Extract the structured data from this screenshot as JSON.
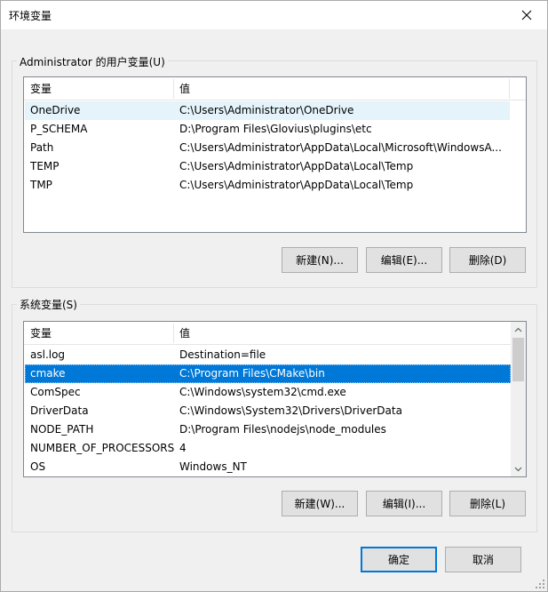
{
  "window": {
    "title": "环境变量"
  },
  "user_vars": {
    "group_label": "Administrator 的用户变量(U)",
    "col_name": "变量",
    "col_value": "值",
    "rows": [
      {
        "name": "OneDrive",
        "value": "C:\\Users\\Administrator\\OneDrive"
      },
      {
        "name": "P_SCHEMA",
        "value": "D:\\Program Files\\Glovius\\plugins\\etc"
      },
      {
        "name": "Path",
        "value": "C:\\Users\\Administrator\\AppData\\Local\\Microsoft\\WindowsA..."
      },
      {
        "name": "TEMP",
        "value": "C:\\Users\\Administrator\\AppData\\Local\\Temp"
      },
      {
        "name": "TMP",
        "value": "C:\\Users\\Administrator\\AppData\\Local\\Temp"
      }
    ],
    "new_label": "新建(N)...",
    "edit_label": "编辑(E)...",
    "delete_label": "删除(D)"
  },
  "system_vars": {
    "group_label": "系统变量(S)",
    "col_name": "变量",
    "col_value": "值",
    "rows": [
      {
        "name": "asl.log",
        "value": "Destination=file"
      },
      {
        "name": "cmake",
        "value": "C:\\Program Files\\CMake\\bin"
      },
      {
        "name": "ComSpec",
        "value": "C:\\Windows\\system32\\cmd.exe"
      },
      {
        "name": "DriverData",
        "value": "C:\\Windows\\System32\\Drivers\\DriverData"
      },
      {
        "name": "NODE_PATH",
        "value": "D:\\Program Files\\nodejs\\node_modules"
      },
      {
        "name": "NUMBER_OF_PROCESSORS",
        "value": "4"
      },
      {
        "name": "OS",
        "value": "Windows_NT"
      }
    ],
    "selected_row": "cmake",
    "new_label": "新建(W)...",
    "edit_label": "编辑(I)...",
    "delete_label": "删除(L)"
  },
  "footer": {
    "ok_label": "确定",
    "cancel_label": "取消"
  },
  "colors": {
    "selection": "#0078d7",
    "hover_row": "#e5f3fb",
    "default_button_border": "#0078d7"
  },
  "icons": {
    "close": "close-icon",
    "scroll_up": "chevron-up-icon",
    "scroll_down": "chevron-down-icon",
    "resize": "resize-grip-icon"
  }
}
